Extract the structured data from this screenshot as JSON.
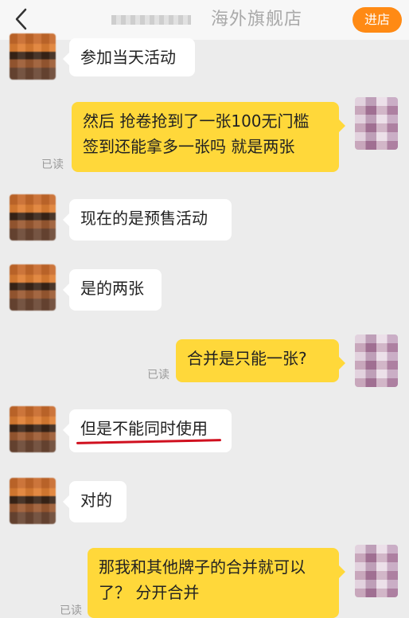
{
  "header": {
    "title": "海外旗舰店",
    "store_button": "进店",
    "back_icon": "chevron-left-icon"
  },
  "messages": [
    {
      "side": "left",
      "text": "参加当天活动"
    },
    {
      "side": "right",
      "text_line1": "然后 抢卷抢到了一张100无门槛",
      "text_line2": "签到还能拿多一张吗 就是两张",
      "status": "已读"
    },
    {
      "side": "left",
      "text": "现在的是预售活动"
    },
    {
      "side": "left",
      "text": "是的两张"
    },
    {
      "side": "right",
      "text": "合并是只能一张?",
      "status": "已读"
    },
    {
      "side": "left",
      "text": "但是不能同时使用",
      "underlined": true
    },
    {
      "side": "left",
      "text": "对的"
    },
    {
      "side": "right",
      "text_line1": "那我和其他牌子的合并就可以",
      "text_line2": "了？ 分开合并",
      "status": "已读"
    }
  ],
  "colors": {
    "accent": "#ff8a14",
    "my_bubble": "#ffd83a",
    "their_bubble": "#ffffff",
    "underline": "#d0101f",
    "background": "#ececec"
  }
}
